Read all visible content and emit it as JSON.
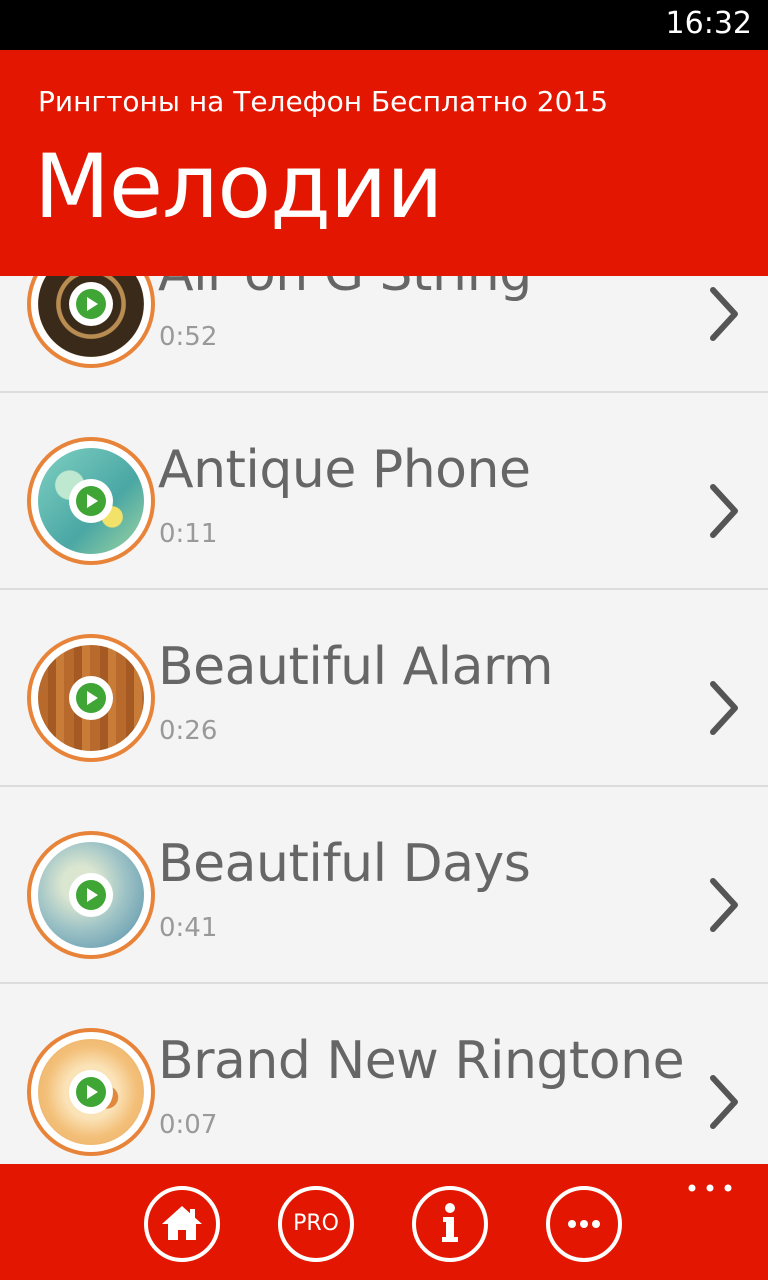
{
  "status_bar": {
    "time": "16:32"
  },
  "header": {
    "subtitle": "Рингтоны на Телефон Бесплатно 2015",
    "title": "Мелодии"
  },
  "ringtones": [
    {
      "name": "Air on G String",
      "duration": "0:52",
      "art": "dark-brown"
    },
    {
      "name": "Antique Phone",
      "duration": "0:11",
      "art": "teal-bokeh"
    },
    {
      "name": "Beautiful Alarm",
      "duration": "0:26",
      "art": "wood"
    },
    {
      "name": "Beautiful Days",
      "duration": "0:41",
      "art": "pale-blue"
    },
    {
      "name": "Brand New Ringtone",
      "duration": "0:07",
      "art": "peach-swirl"
    }
  ],
  "app_bar": {
    "buttons": [
      {
        "name": "home",
        "icon": "home-icon"
      },
      {
        "name": "pro",
        "label": "PRO"
      },
      {
        "name": "info",
        "icon": "info-icon"
      },
      {
        "name": "more",
        "icon": "ellipsis-icon"
      }
    ],
    "overflow_icon": "more-dots-icon"
  },
  "colors": {
    "accent": "#e31701",
    "ring": "#e8843a",
    "play": "#3fa535"
  }
}
